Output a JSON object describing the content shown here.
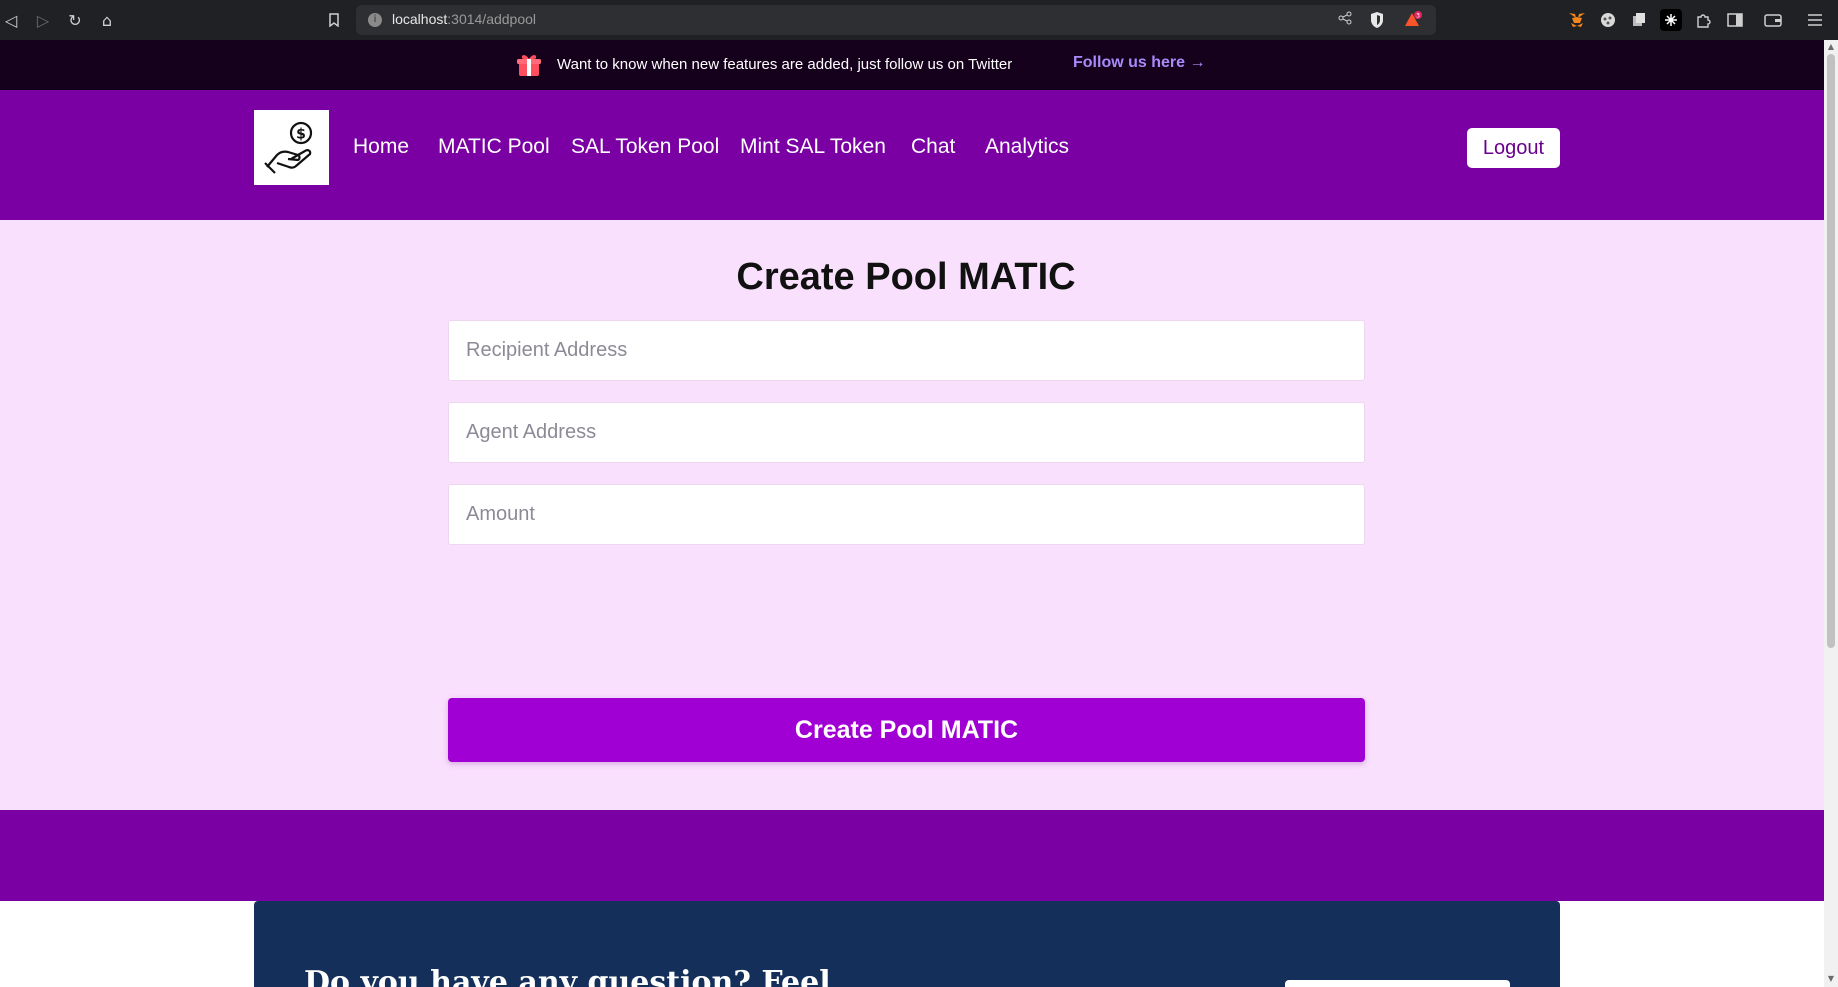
{
  "browser": {
    "url_host": "localhost",
    "url_path": ":3014/addpool",
    "notification_count": "3"
  },
  "announcement": {
    "text": "Want to know when new features are added, just follow us on Twitter",
    "link_label": "Follow us here →"
  },
  "nav": {
    "items": [
      {
        "label": "Home"
      },
      {
        "label": "MATIC Pool"
      },
      {
        "label": "SAL Token Pool"
      },
      {
        "label": "Mint SAL Token"
      },
      {
        "label": "Chat"
      },
      {
        "label": "Analytics"
      }
    ],
    "logout_label": "Logout"
  },
  "form": {
    "title": "Create Pool MATIC",
    "recipient_placeholder": "Recipient Address",
    "agent_placeholder": "Agent Address",
    "amount_placeholder": "Amount",
    "submit_label": "Create Pool MATIC"
  },
  "cta": {
    "heading": "Do you have any question? Feel"
  },
  "colors": {
    "brand_purple": "#7a00a3",
    "button_purple": "#a100d4",
    "page_bg": "#f9e0fd",
    "announce_bg": "#16011c",
    "cta_bg": "#14305a"
  },
  "icons": {
    "logo": "hand-holding-coin-icon",
    "announce": "gift-icon"
  }
}
